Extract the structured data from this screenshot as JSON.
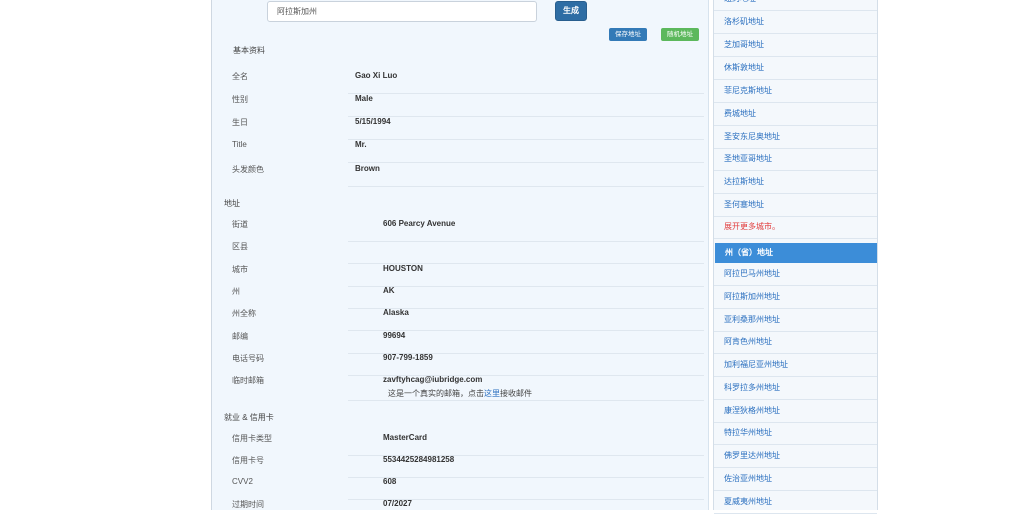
{
  "search": {
    "value": "阿拉斯加州"
  },
  "buttons": {
    "generate": "生成",
    "save": "保存地址",
    "random": "随机地址"
  },
  "sections": {
    "basic": "基本资料",
    "address": "地址",
    "employment": "就业 & 信用卡"
  },
  "basic": [
    {
      "label": "全名",
      "value": "Gao Xi Luo"
    },
    {
      "label": "性别",
      "value": "Male"
    },
    {
      "label": "生日",
      "value": "5/15/1994"
    },
    {
      "label": "Title",
      "value": "Mr."
    },
    {
      "label": "头发颜色",
      "value": "Brown"
    }
  ],
  "address": [
    {
      "label": "街道",
      "value": "606  Pearcy Avenue"
    },
    {
      "label": "区县",
      "value": ""
    },
    {
      "label": "城市",
      "value": "HOUSTON"
    },
    {
      "label": "州",
      "value": "AK"
    },
    {
      "label": "州全称",
      "value": "Alaska"
    },
    {
      "label": "邮编",
      "value": "99694"
    },
    {
      "label": "电话号码",
      "value": "907-799-1859"
    },
    {
      "label": "临时邮箱",
      "value": "zavftyhcag@iubridge.com"
    }
  ],
  "email_note": {
    "before": "这是一个真实的邮箱，点击",
    "link": "这里",
    "after": "接收邮件"
  },
  "employment": [
    {
      "label": "信用卡类型",
      "value": "MasterCard"
    },
    {
      "label": "信用卡号",
      "value": "5534425284981258"
    },
    {
      "label": "CVV2",
      "value": "608"
    },
    {
      "label": "过期时间",
      "value": "07/2027"
    }
  ],
  "sidebar": {
    "cities_partial_top": "纽约地址",
    "cities": [
      "洛杉矶地址",
      "芝加哥地址",
      "休斯敦地址",
      "菲尼克斯地址",
      "费城地址",
      "圣安东尼奥地址",
      "圣地亚哥地址",
      "达拉斯地址",
      "圣何塞地址"
    ],
    "more_cities": "展开更多城市。",
    "states_header": "州（省）地址",
    "states": [
      "阿拉巴马州地址",
      "阿拉斯加州地址",
      "亚利桑那州地址",
      "阿肯色州地址",
      "加利福尼亚州地址",
      "科罗拉多州地址",
      "康涅狄格州地址",
      "特拉华州地址",
      "佛罗里达州地址",
      "佐治亚州地址",
      "夏威夷州地址"
    ]
  }
}
